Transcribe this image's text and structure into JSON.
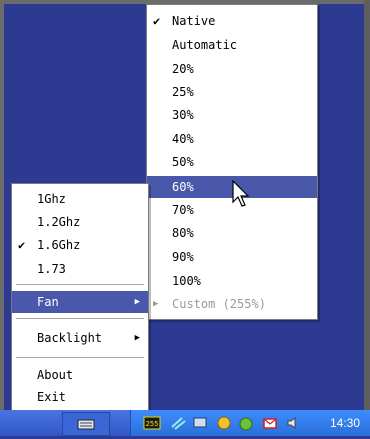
{
  "fan_menu": {
    "items": [
      {
        "label": "Native",
        "checked": true
      },
      {
        "label": "Automatic"
      },
      {
        "label": "20%"
      },
      {
        "label": "25%"
      },
      {
        "label": "30%"
      },
      {
        "label": "40%"
      },
      {
        "label": "50%"
      },
      {
        "label": "60%",
        "selected": true
      },
      {
        "label": "70%"
      },
      {
        "label": "80%"
      },
      {
        "label": "90%"
      },
      {
        "label": "100%"
      },
      {
        "label": "Custom (255%)",
        "disabled": true
      }
    ]
  },
  "main_menu": {
    "cpu_items": [
      {
        "label": "1Ghz"
      },
      {
        "label": "1.2Ghz"
      },
      {
        "label": "1.6Ghz",
        "checked": true
      },
      {
        "label": "1.73"
      }
    ],
    "fan_label": "Fan",
    "backlight_label": "Backlight",
    "about_label": "About",
    "exit_label": "Exit"
  },
  "taskbar": {
    "clock": "14:30",
    "tray_badge": "255"
  },
  "icons": {
    "check": "check-icon",
    "submenu": "chevron-right-icon",
    "cursor": "mouse-pointer-icon"
  }
}
